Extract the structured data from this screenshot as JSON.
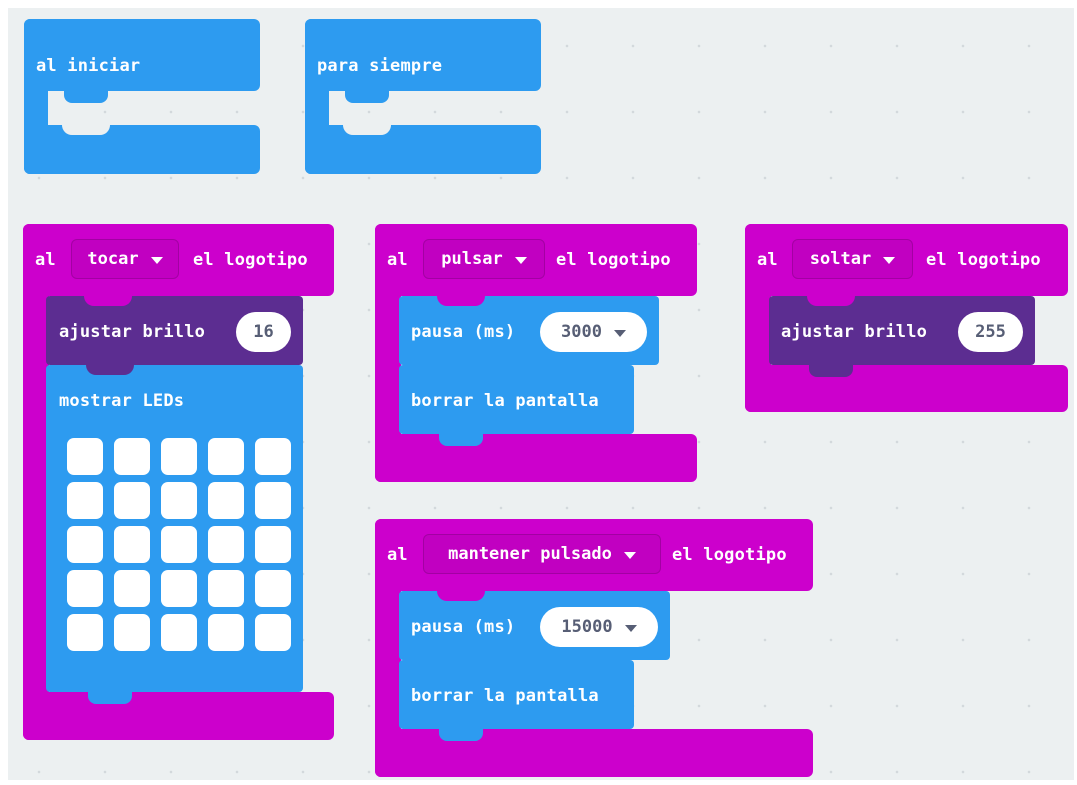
{
  "colors": {
    "loop_blue": "#2d9bf0",
    "input_magenta": "#cc00cc",
    "led_purple": "#5c2d91",
    "workspace": "#ecf0f1"
  },
  "blocks": {
    "on_start": {
      "label": "al iniciar"
    },
    "forever": {
      "label": "para siempre"
    },
    "touch": {
      "prefix": "al",
      "option": "tocar",
      "suffix": "el logotipo",
      "brightness": {
        "label": "ajustar brillo",
        "value": "16"
      },
      "show_leds": {
        "label": "mostrar LEDs",
        "grid": "5x5",
        "lit": []
      }
    },
    "press": {
      "prefix": "al",
      "option": "pulsar",
      "suffix": "el logotipo",
      "pause": {
        "label": "pausa (ms)",
        "value": "3000"
      },
      "clear": {
        "label": "borrar la pantalla"
      }
    },
    "release": {
      "prefix": "al",
      "option": "soltar",
      "suffix": "el logotipo",
      "brightness": {
        "label": "ajustar brillo",
        "value": "255"
      }
    },
    "long_press": {
      "prefix": "al",
      "option": "mantener pulsado",
      "suffix": "el logotipo",
      "pause": {
        "label": "pausa (ms)",
        "value": "15000"
      },
      "clear": {
        "label": "borrar la pantalla"
      }
    }
  }
}
